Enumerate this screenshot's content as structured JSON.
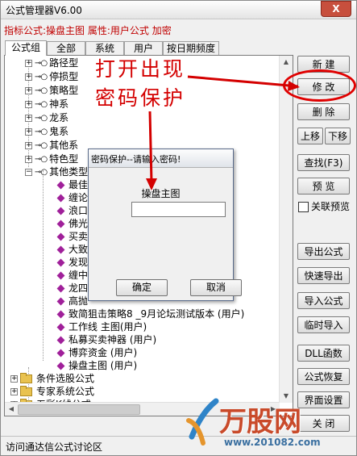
{
  "window": {
    "title": "公式管理器V6.00",
    "close_label": "X",
    "info_line": "指标公式:操盘主图 属性:用户公式 加密"
  },
  "tabs": [
    "公式组",
    "全部",
    "系统",
    "用户",
    "按日期频度"
  ],
  "tree": {
    "groups_top": [
      "路径型",
      "停损型",
      "策略型",
      "神系",
      "龙系",
      "鬼系",
      "其他系",
      "特色型",
      "其他类型"
    ],
    "formulas": [
      "最佳",
      "缠论",
      "浪口",
      "佛光",
      "买卖",
      "大致",
      "发现",
      "缠中",
      "龙四",
      "高抛",
      "致简狙击策略8  _9月论坛测试版本 (用户)",
      "工作线  主图(用户)",
      "私募买卖神器  (用户)",
      "博弈资金  (用户)",
      "操盘主图  (用户)"
    ],
    "folders_bottom": [
      "条件选股公式",
      "专家系统公式",
      "五彩K线公式"
    ]
  },
  "buttons": {
    "new": "新 建",
    "modify": "修 改",
    "delete": "删 除",
    "move_up": "上移",
    "move_down": "下移",
    "find": "查找(F3)",
    "preview": "预 览",
    "link_preview": "关联预览",
    "export": "导出公式",
    "quick_export": "快速导出",
    "import": "导入公式",
    "temp_import": "临时导入",
    "dll": "DLL函数",
    "restore": "公式恢复",
    "ui_settings": "界面设置",
    "close": "关 闭"
  },
  "status": "访问通达信公式讨论区",
  "dialog": {
    "title": "密码保护--请输入密码!",
    "formula_name": "操盘主图",
    "password_value": "",
    "ok": "确定",
    "cancel": "取消"
  },
  "annotation": {
    "line1": "打开出现",
    "line2": "密码保护"
  },
  "watermark": {
    "brand": "万股网",
    "url": "www.201082.com"
  },
  "colors": {
    "annotation_red": "#d40000",
    "info_red": "#c00000",
    "formula_icon": "#a0209a",
    "folder": "#e9c24f"
  }
}
